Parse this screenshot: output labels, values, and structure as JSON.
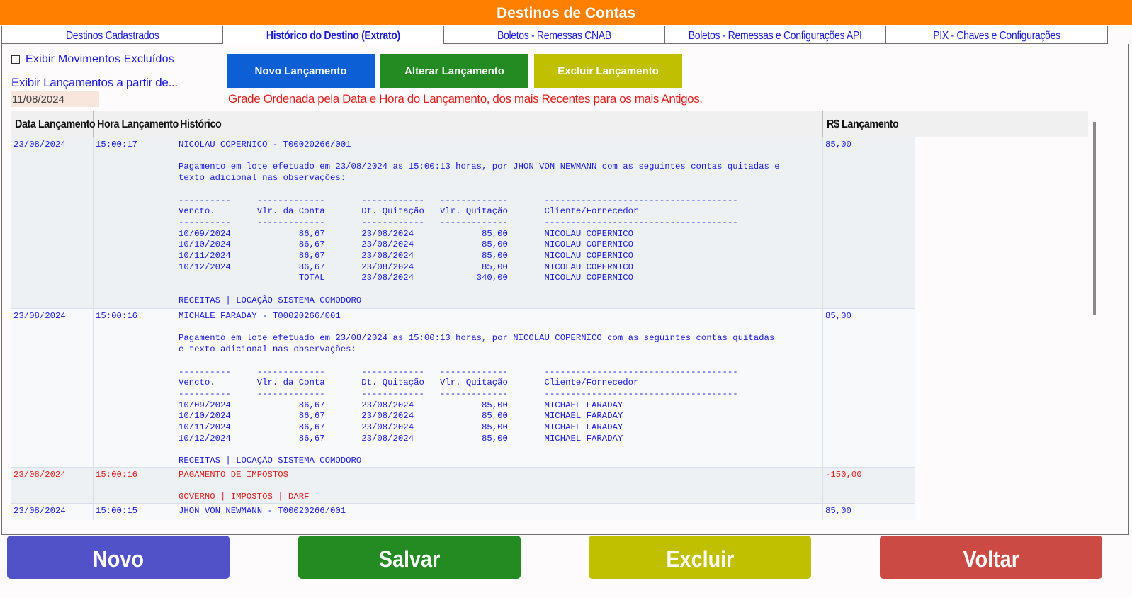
{
  "window": {
    "title": "Destinos de Contas"
  },
  "tabs": [
    {
      "label": "Destinos Cadastrados"
    },
    {
      "label": "Histórico do Destino (Extrato)"
    },
    {
      "label": "Boletos - Remessas CNAB"
    },
    {
      "label": "Boletos - Remessas e Configurações API"
    },
    {
      "label": "PIX - Chaves e Configurações"
    }
  ],
  "filters": {
    "show_deleted_label": "Exibir Movimentos Excluídos",
    "date_caption": "Exibir Lançamentos a partir de...",
    "date_value": "11/08/2024"
  },
  "actions": {
    "new_label": "Novo Lançamento",
    "edit_label": "Alterar Lançamento",
    "delete_label": "Excluir Lançamento"
  },
  "grid_note": "Grade Ordenada pela Data e Hora do Lançamento, dos mais Recentes para os mais Antigos.",
  "grid": {
    "columns": [
      "Data Lançamento",
      "Hora Lançamento",
      "Histórico",
      "R$ Lançamento"
    ],
    "rows": [
      {
        "date": "23/08/2024",
        "time": "15:00:17",
        "history": "NICOLAU COPERNICO - T00020266/001\n\nPagamento em lote efetuado em 23/08/2024 as 15:00:13 horas, por JHON VON NEWMANN com as seguintes contas quitadas e\ntexto adicional nas observações:\n\n----------     -------------       ------------   -------------       -------------------------------------\nVencto.        Vlr. da Conta       Dt. Quitação   Vlr. Quitação       Cliente/Fornecedor\n----------     -------------       ------------   -------------       -------------------------------------\n10/09/2024             86,67       23/08/2024             85,00       NICOLAU COPERNICO\n10/10/2024             86,67       23/08/2024             85,00       NICOLAU COPERNICO\n10/11/2024             86,67       23/08/2024             85,00       NICOLAU COPERNICO\n10/12/2024             86,67       23/08/2024             85,00       NICOLAU COPERNICO\n                       TOTAL       23/08/2024            340,00       NICOLAU COPERNICO\n\nRECEITAS | LOCAÇÃO SISTEMA COMODORO",
        "amount": "85,00"
      },
      {
        "date": "23/08/2024",
        "time": "15:00:16",
        "history": "MICHALE FARADAY - T00020266/001\n\nPagamento em lote efetuado em 23/08/2024 as 15:00:13 horas, por NICOLAU COPERNICO com as seguintes contas quitadas\ne texto adicional nas observações:\n\n----------     -------------       ------------   -------------       -------------------------------------\nVencto.        Vlr. da Conta       Dt. Quitação   Vlr. Quitação       Cliente/Fornecedor\n----------     -------------       ------------   -------------       -------------------------------------\n10/09/2024             86,67       23/08/2024             85,00       MICHAEL FARADAY\n10/10/2024             86,67       23/08/2024             85,00       MICHAEL FARADAY\n10/11/2024             86,67       23/08/2024             85,00       MICHAEL FARADAY\n10/12/2024             86,67       23/08/2024             85,00       MICHAEL FARADAY\n\nRECEITAS | LOCAÇÃO SISTEMA COMODORO",
        "amount": "85,00"
      },
      {
        "date": "23/08/2024",
        "time": "15:00:16",
        "history": "PAGAMENTO DE IMPOSTOS\n\nGOVERNO | IMPOSTOS | DARF",
        "amount": "-150,00"
      },
      {
        "date": "23/08/2024",
        "time": "15:00:15",
        "history": "JHON VON NEWMANN - T00020266/001",
        "amount": "85,00"
      }
    ]
  },
  "footer": {
    "new_label": "Novo",
    "save_label": "Salvar",
    "delete_label": "Excluir",
    "back_label": "Voltar"
  },
  "colors": {
    "title_bar": "#ff8000",
    "tab_text": "#1a1ad8",
    "btn_new_entry": "#0d5fd6",
    "btn_edit_entry": "#238b22",
    "btn_delete_entry": "#c0c000",
    "footer_new": "#5252c8",
    "footer_save": "#238b22",
    "footer_delete": "#c0c000",
    "footer_back": "#cc4a44",
    "negative_text": "#e02020"
  }
}
